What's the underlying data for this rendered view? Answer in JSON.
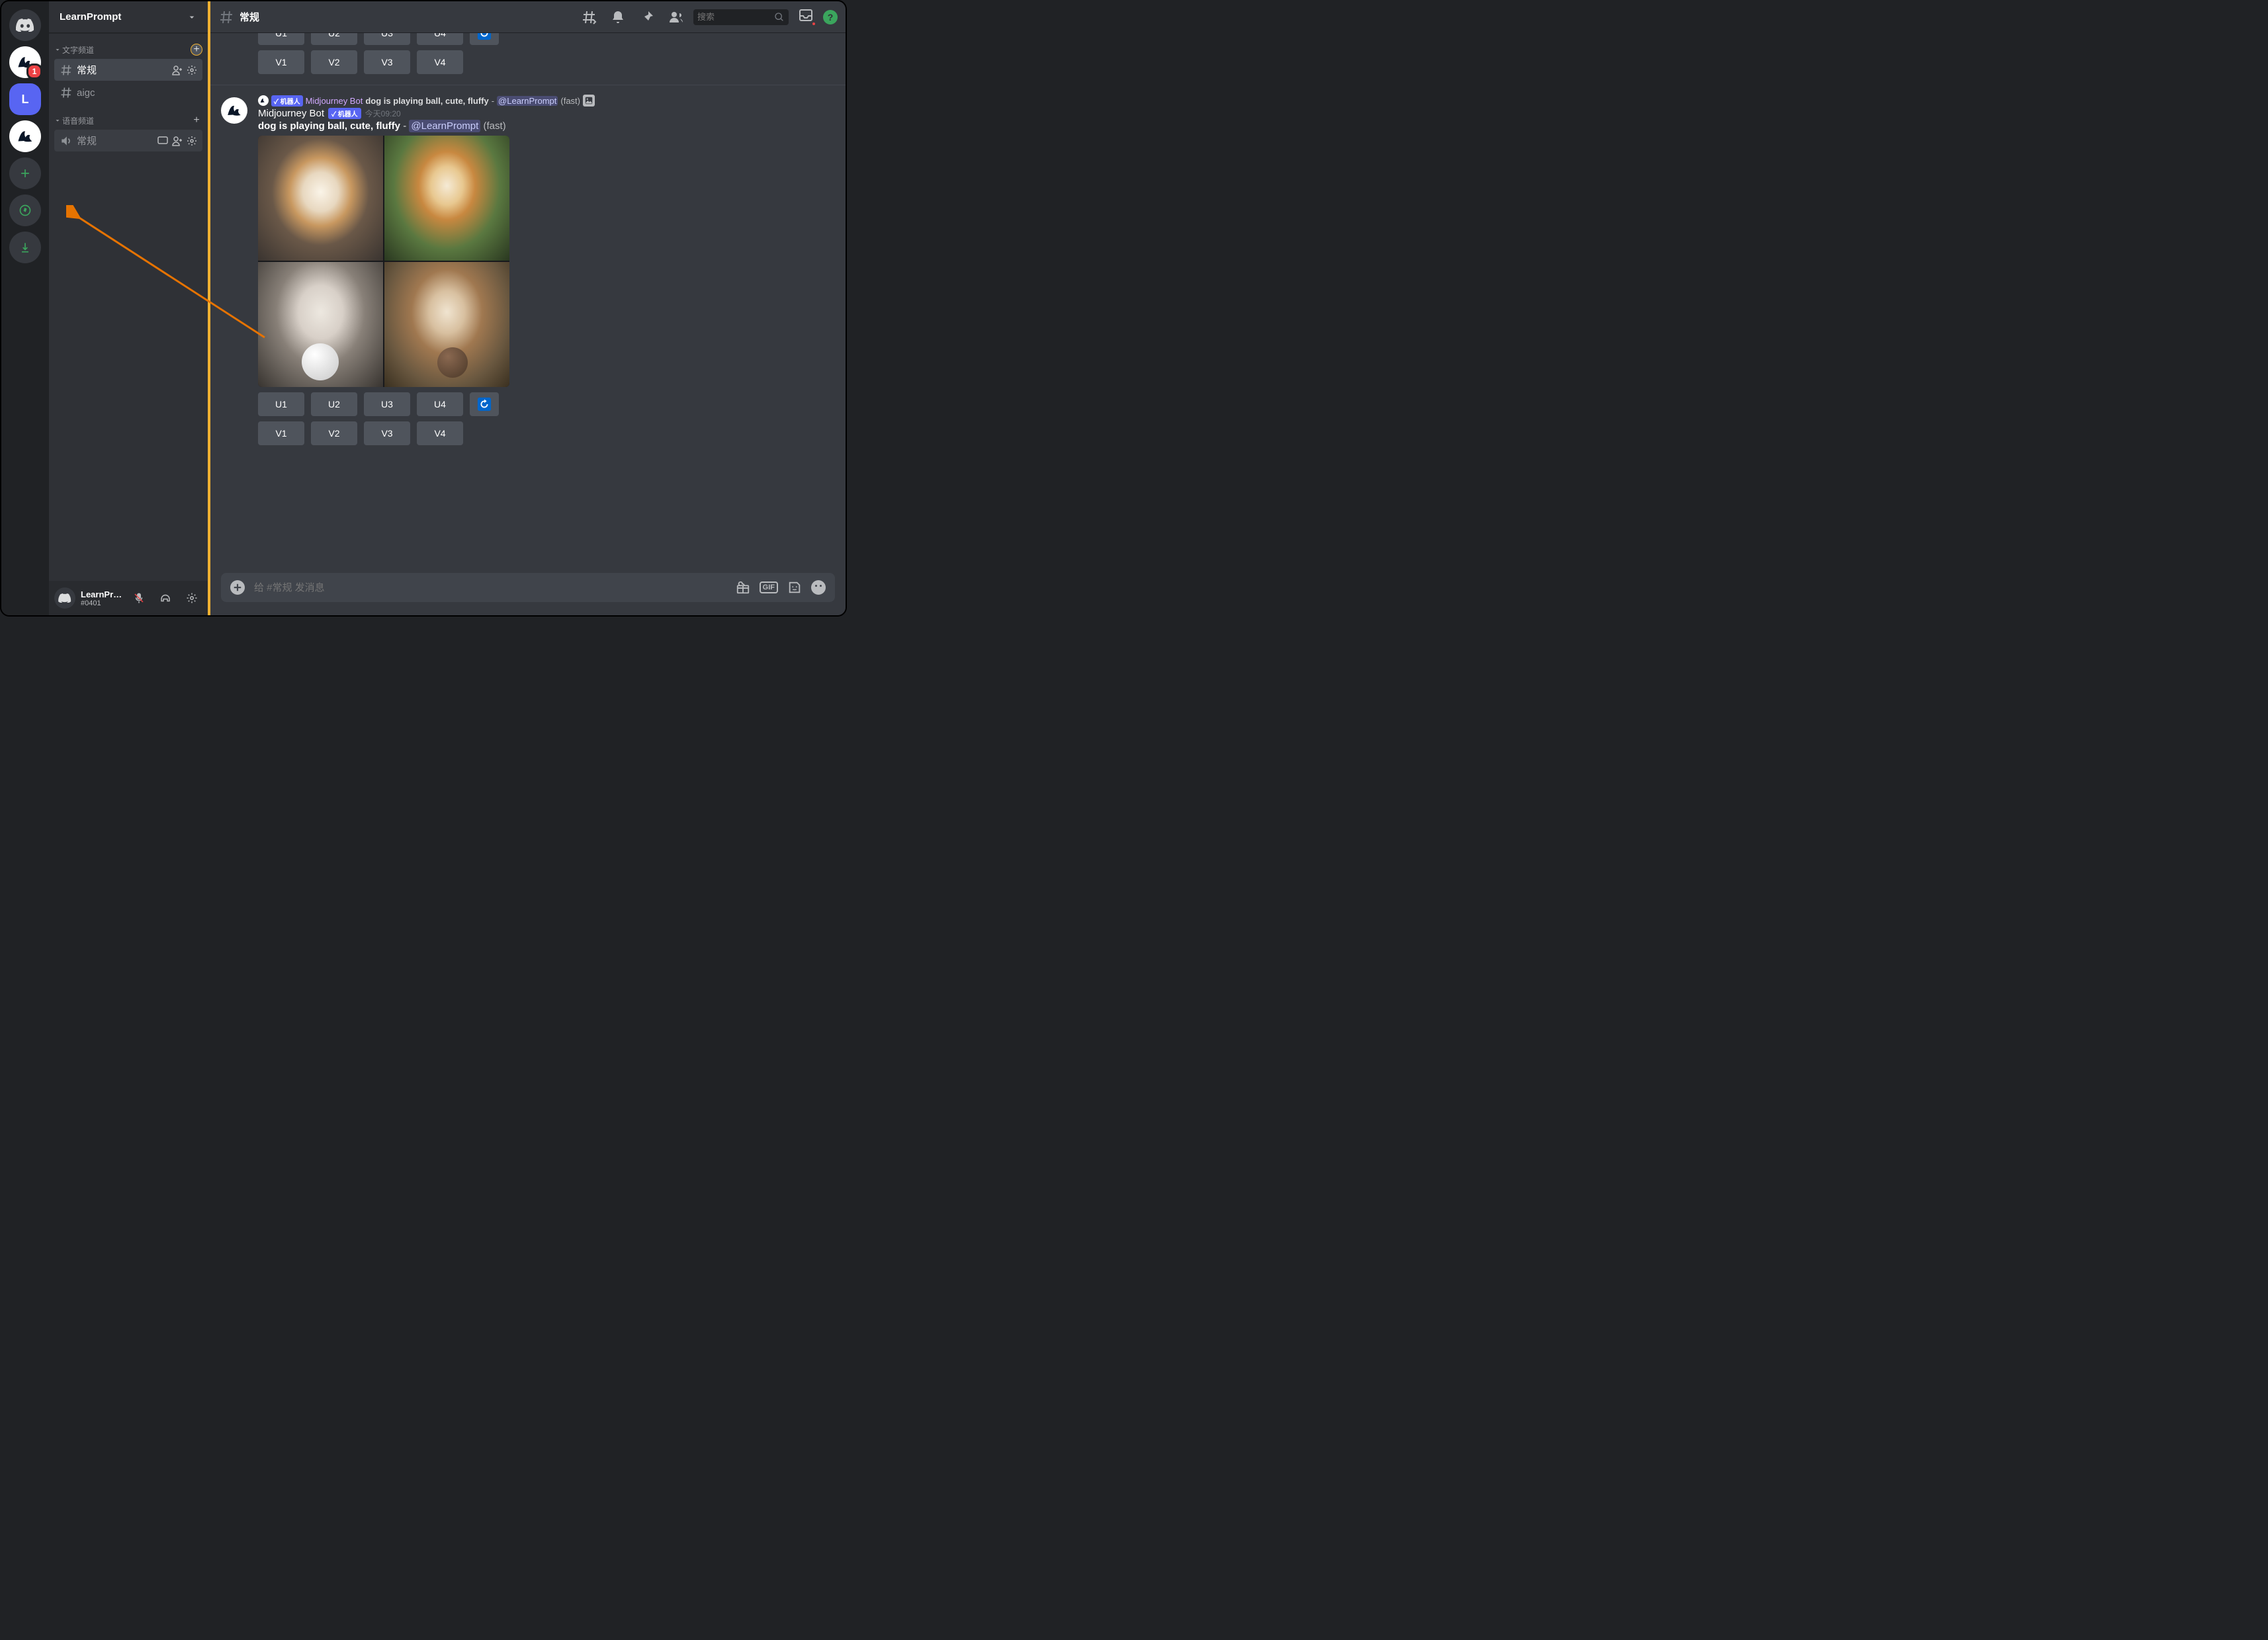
{
  "server": {
    "name": "LearnPrompt",
    "badge": "1",
    "letter": "L"
  },
  "categories": {
    "text": {
      "label": "文字频道",
      "channels": [
        {
          "name": "常规",
          "active": true,
          "id": "general"
        },
        {
          "name": "aigc",
          "active": false,
          "id": "aigc"
        }
      ]
    },
    "voice": {
      "label": "语音频道",
      "channels": [
        {
          "name": "常规",
          "id": "voice-general"
        }
      ]
    }
  },
  "user": {
    "name": "LearnPro...",
    "tag": "#0401"
  },
  "topbar": {
    "channel": "常规",
    "search_placeholder": "搜索"
  },
  "buttons": {
    "u1": "U1",
    "u2": "U2",
    "u3": "U3",
    "u4": "U4",
    "v1": "V1",
    "v2": "V2",
    "v3": "V3",
    "v4": "V4"
  },
  "bot": {
    "name": "Midjourney Bot",
    "tag": "✓ 机器人",
    "tag_short": "✓ 机器人"
  },
  "msg1": {
    "reply_bot": "Midjourney Bot",
    "reply_text": "dog is playing ball, cute, fluffy",
    "reply_mention": "@LearnPrompt",
    "reply_mode": "(fast)"
  },
  "msg2": {
    "author": "Midjourney Bot",
    "timestamp": "今天09:20",
    "prompt": "dog is playing ball, cute, fluffy",
    "mention": "@LearnPrompt",
    "mode": "(fast)"
  },
  "composer": {
    "placeholder": "给 #常规 发消息"
  },
  "icons": {
    "gif": "GIF",
    "help": "?"
  }
}
